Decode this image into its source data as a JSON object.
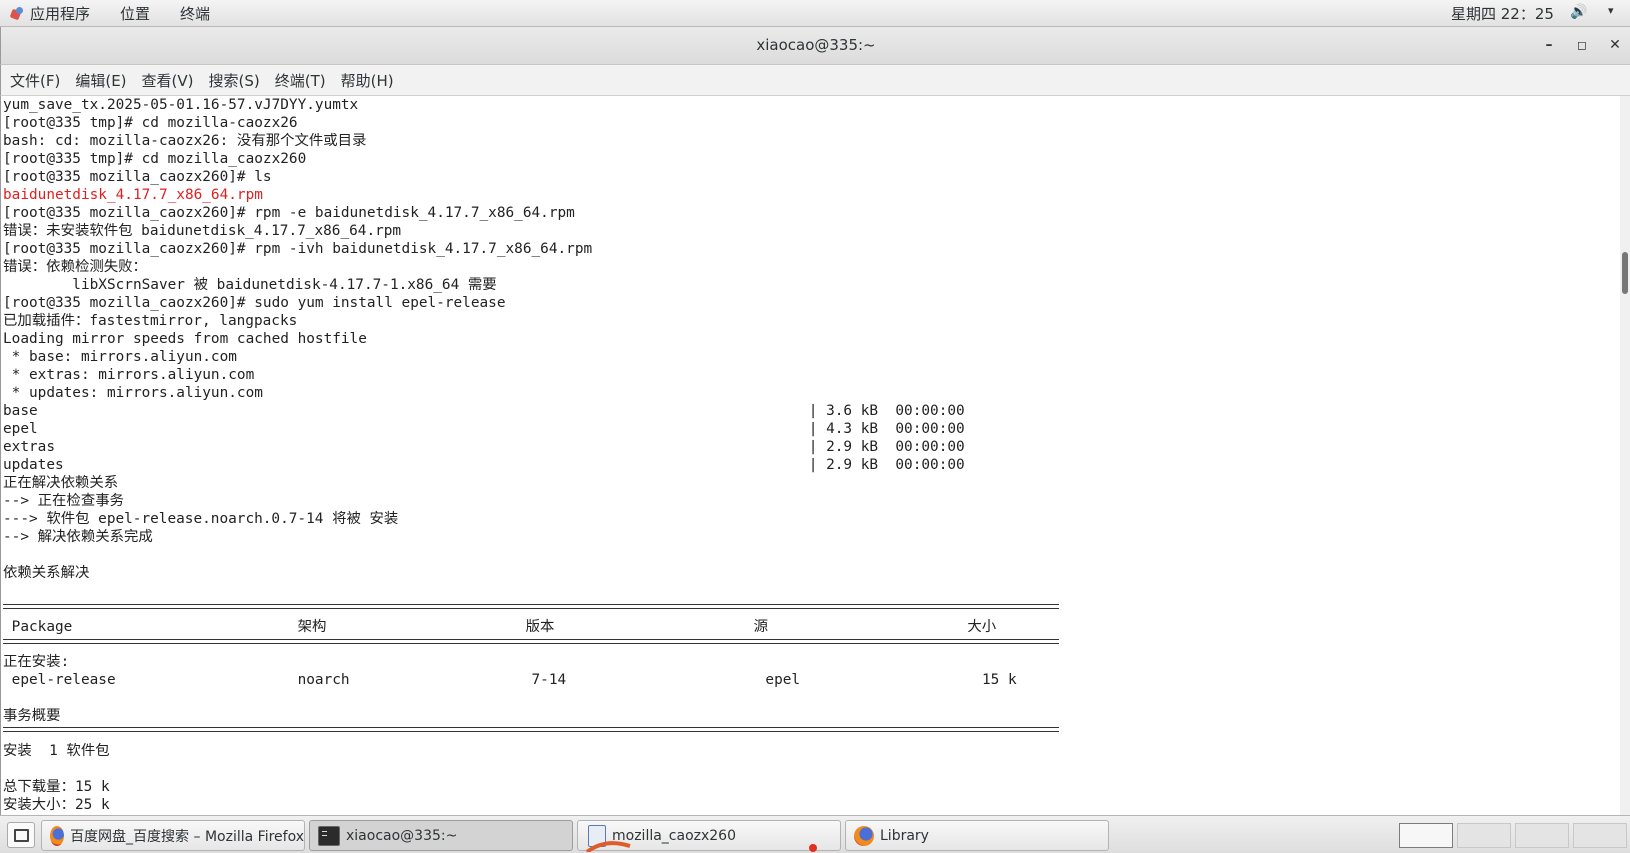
{
  "top_panel": {
    "applications": "应用程序",
    "places": "位置",
    "terminal": "终端",
    "clock": "星期四 22：25",
    "volume_icon": "speaker-icon",
    "menu_arrow": "▾"
  },
  "window": {
    "title": "xiaocao@335:~",
    "minimize": "–",
    "maximize": "◻",
    "close": "✕"
  },
  "menubar": {
    "file": "文件(F)",
    "edit": "编辑(E)",
    "view": "查看(V)",
    "search": "搜索(S)",
    "terminal": "终端(T)",
    "help": "帮助(H)"
  },
  "terminal": {
    "lines": [
      "yum_save_tx.2025-05-01.16-57.vJ7DYY.yumtx",
      "[root@335 tmp]# cd mozilla-caozx26",
      "bash: cd: mozilla-caozx26: 没有那个文件或目录",
      "[root@335 tmp]# cd mozilla_caozx260",
      "[root@335 mozilla_caozx260]# ls",
      "baidunetdisk_4.17.7_x86_64.rpm",
      "[root@335 mozilla_caozx260]# rpm -e baidunetdisk_4.17.7_x86_64.rpm",
      "错误：未安装软件包 baidunetdisk_4.17.7_x86_64.rpm",
      "[root@335 mozilla_caozx260]# rpm -ivh baidunetdisk_4.17.7_x86_64.rpm",
      "错误：依赖检测失败：",
      "        libXScrnSaver 被 baidunetdisk-4.17.7-1.x86_64 需要",
      "[root@335 mozilla_caozx260]# sudo yum install epel-release",
      "已加载插件：fastestmirror, langpacks",
      "Loading mirror speeds from cached hostfile",
      " * base: mirrors.aliyun.com",
      " * extras: mirrors.aliyun.com",
      " * updates: mirrors.aliyun.com",
      "base                                                                                         | 3.6 kB  00:00:00",
      "epel                                                                                         | 4.3 kB  00:00:00",
      "extras                                                                                       | 2.9 kB  00:00:00",
      "updates                                                                                      | 2.9 kB  00:00:00",
      "正在解决依赖关系",
      "--> 正在检查事务",
      "---> 软件包 epel-release.noarch.0.7-14 将被 安装",
      "--> 解决依赖关系完成",
      "",
      "依赖关系解决",
      "",
      "",
      " Package                          架构                       版本                       源                       大小",
      "",
      "正在安装:",
      " epel-release                     noarch                     7-14                       epel                     15 k",
      "",
      "事务概要",
      "",
      "安装  1 软件包",
      "",
      "总下载量：15 k",
      "安装大小：25 k"
    ]
  },
  "taskbar": {
    "show_desktop_icon": "show-desktop-icon",
    "items": [
      {
        "label": "百度网盘_百度搜索 – Mozilla Firefox",
        "icon": "firefox-icon"
      },
      {
        "label": "xiaocao@335:~",
        "icon": "terminal-icon"
      },
      {
        "label": "mozilla_caozx260",
        "icon": "file-manager-icon"
      },
      {
        "label": "Library",
        "icon": "firefox-icon"
      }
    ],
    "workspaces": 4
  }
}
